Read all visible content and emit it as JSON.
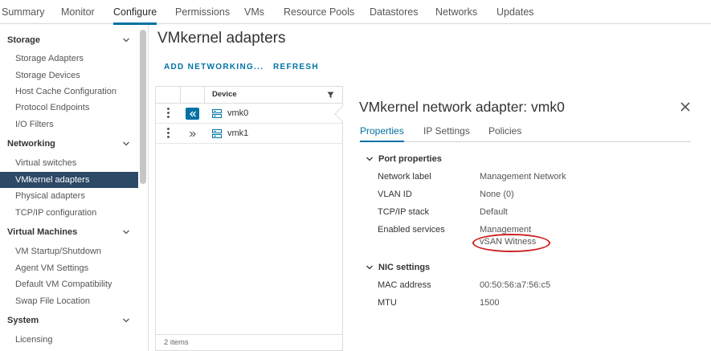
{
  "top_tabs": [
    "Summary",
    "Monitor",
    "Configure",
    "Permissions",
    "VMs",
    "Resource Pools",
    "Datastores",
    "Networks",
    "Updates"
  ],
  "active_top_tab": "Configure",
  "sidebar": {
    "sections": [
      {
        "label": "Storage",
        "items": [
          "Storage Adapters",
          "Storage Devices",
          "Host Cache Configuration",
          "Protocol Endpoints",
          "I/O Filters"
        ]
      },
      {
        "label": "Networking",
        "items": [
          "Virtual switches",
          "VMkernel adapters",
          "Physical adapters",
          "TCP/IP configuration"
        ]
      },
      {
        "label": "Virtual Machines",
        "items": [
          "VM Startup/Shutdown",
          "Agent VM Settings",
          "Default VM Compatibility",
          "Swap File Location"
        ]
      },
      {
        "label": "System",
        "items": [
          "Licensing"
        ]
      }
    ],
    "active_item": "VMkernel adapters"
  },
  "main": {
    "title": "VMkernel adapters",
    "actions": {
      "add": "ADD NETWORKING...",
      "refresh": "REFRESH"
    }
  },
  "grid": {
    "column_device": "Device",
    "rows": [
      {
        "device": "vmk0",
        "expanded": true
      },
      {
        "device": "vmk1",
        "expanded": false
      }
    ],
    "footer": "2 items"
  },
  "detail": {
    "title": "VMkernel network adapter: vmk0",
    "tabs": [
      "Properties",
      "IP Settings",
      "Policies"
    ],
    "active_tab": "Properties",
    "port_properties": {
      "heading": "Port properties",
      "rows": [
        {
          "label": "Network label",
          "value": "Management Network"
        },
        {
          "label": "VLAN ID",
          "value": "None (0)"
        },
        {
          "label": "TCP/IP stack",
          "value": "Default"
        },
        {
          "label": "Enabled services",
          "value": "Management",
          "value2": "vSAN Witness"
        }
      ]
    },
    "nic_settings": {
      "heading": "NIC settings",
      "rows": [
        {
          "label": "MAC address",
          "value": "00:50:56:a7:56:c5"
        },
        {
          "label": "MTU",
          "value": "1500"
        }
      ]
    }
  },
  "colors": {
    "accent": "#0072a3",
    "selected_nav": "#2c4965",
    "annotation": "#cc1f1f"
  },
  "icons": {
    "chevron": "chevron-down-icon",
    "filter": "filter-icon",
    "close": "close-icon",
    "nic": "network-adapter-icon"
  }
}
